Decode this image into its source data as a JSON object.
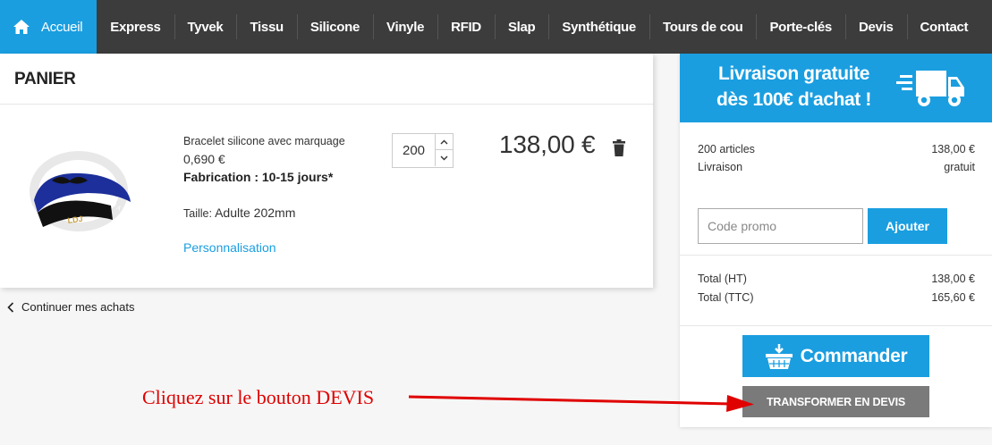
{
  "nav": {
    "home": "Accueil",
    "items": [
      "Express",
      "Tyvek",
      "Tissu",
      "Silicone",
      "Vinyle",
      "RFID",
      "Slap",
      "Synthétique",
      "Tours de cou",
      "Porte-clés",
      "Devis",
      "Contact"
    ]
  },
  "cart": {
    "title": "PANIER",
    "product": {
      "name": "Bracelet silicone avec marquage",
      "unit_price": "0,690 €",
      "fabrication": "Fabrication : 10-15 jours*",
      "size_label": "Taille:",
      "size_value": "Adulte 202mm",
      "customize_link": "Personnalisation",
      "quantity": "200",
      "line_total": "138,00 €",
      "image_text_1": "Blade",
      "image_text_2": "A Run",
      "image_text_3": "LDJ"
    },
    "continue_label": "Continuer mes achats"
  },
  "summary": {
    "banner_line1": "Livraison gratuite",
    "banner_line2": "dès 100€ d'achat !",
    "articles_label": "200 articles",
    "articles_value": "138,00 €",
    "shipping_label": "Livraison",
    "shipping_value": "gratuit",
    "promo_placeholder": "Code promo",
    "promo_button": "Ajouter",
    "total_ht_label": "Total (HT)",
    "total_ht_value": "138,00 €",
    "total_ttc_label": "Total (TTC)",
    "total_ttc_value": "165,60 €",
    "order_button": "Commander",
    "quote_button": "TRANSFORMER EN DEVIS"
  },
  "annotation": {
    "text": "Cliquez sur le bouton DEVIS"
  },
  "colors": {
    "accent": "#1a9ee0",
    "nav_bg": "#3c3c3c",
    "quote_button": "#7a7a7a",
    "annotation": "#e00000"
  }
}
